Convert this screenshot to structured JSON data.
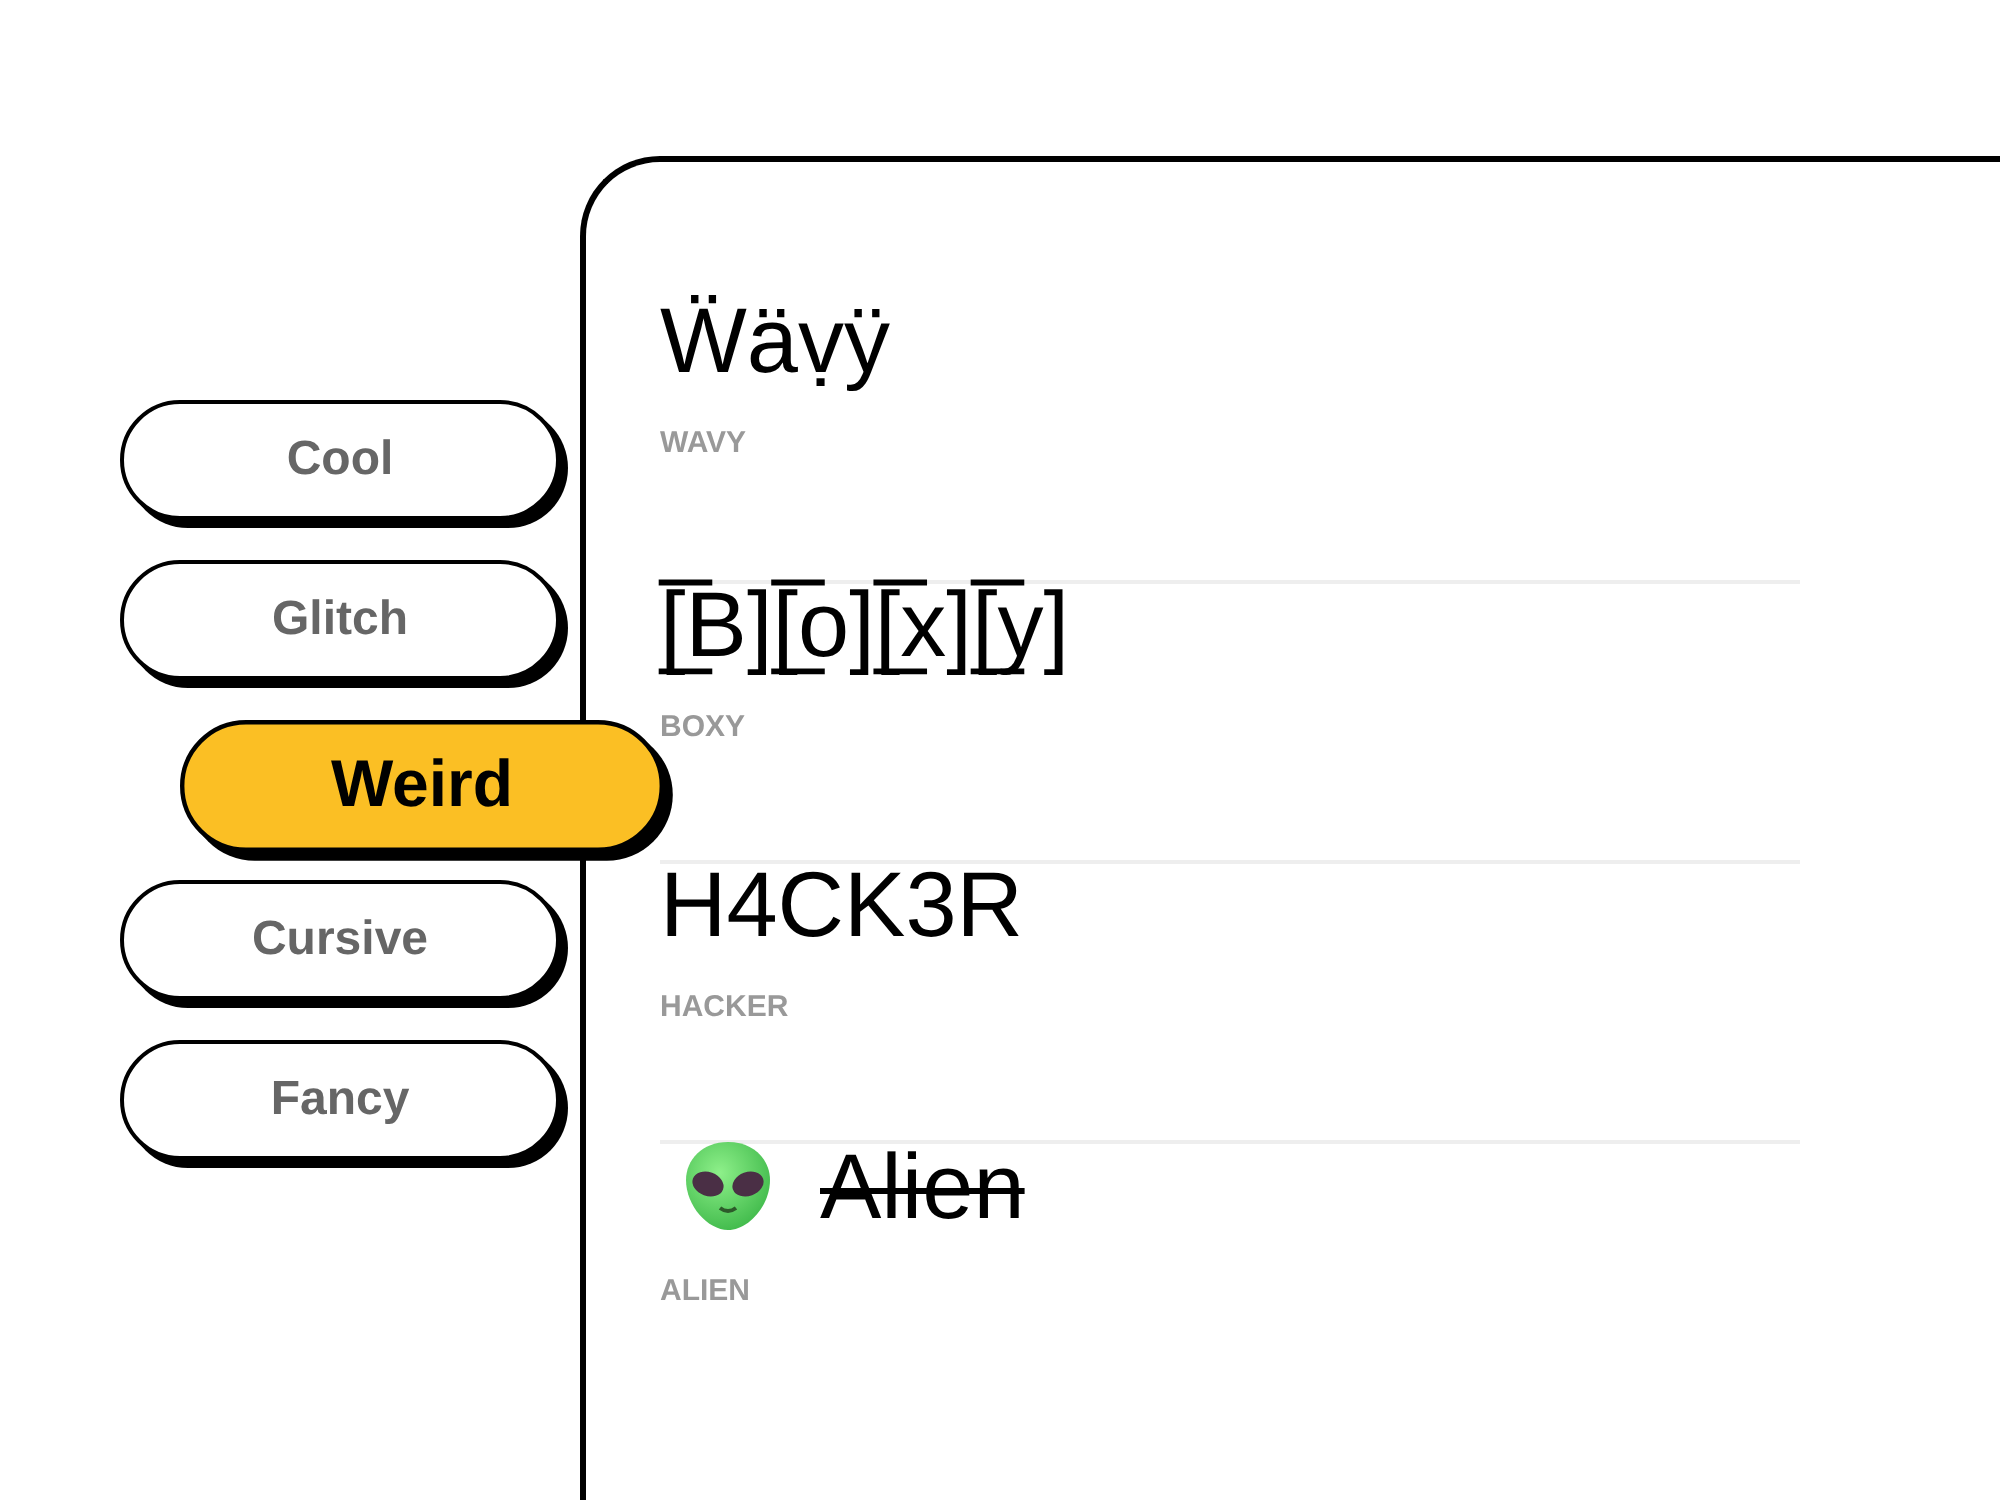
{
  "nav": [
    {
      "label": "Cool",
      "selected": false
    },
    {
      "label": "Glitch",
      "selected": false
    },
    {
      "label": "Weird",
      "selected": true
    },
    {
      "label": "Cursive",
      "selected": false
    },
    {
      "label": "Fancy",
      "selected": false
    }
  ],
  "styles": [
    {
      "kind": "plain",
      "sample": "Ẅäṿÿ",
      "label": "WAVY",
      "struck": false
    },
    {
      "kind": "plain",
      "sample": "[̲̅B][̲̅o][̲̅x][̲̅y]",
      "label": "BOXY",
      "struck": false
    },
    {
      "kind": "plain",
      "sample": "H4CK3R",
      "label": "HACKER",
      "struck": false
    },
    {
      "kind": "alien",
      "sample": "Alien",
      "label": "ALIEN",
      "struck": true
    }
  ]
}
